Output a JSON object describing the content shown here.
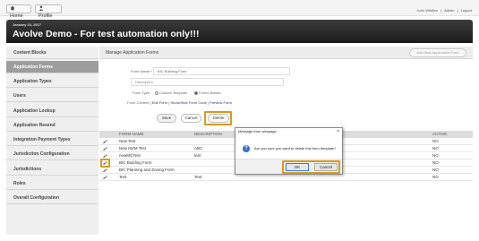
{
  "topbar": {
    "home_label": "Home",
    "profile_label": "Profile",
    "user_name": "John Whitten",
    "admin_label": "Admin",
    "logout_label": "Logout",
    "separator": "|"
  },
  "banner": {
    "date": "January 24, 2017",
    "title": "Avolve Demo - For test automation only!!!"
  },
  "sidebar": {
    "items": [
      {
        "label": "Content Blocks"
      },
      {
        "label": "Application Forms"
      },
      {
        "label": "Application Types"
      },
      {
        "label": "Users"
      },
      {
        "label": "Application Lookup"
      },
      {
        "label": "Application Resend"
      },
      {
        "label": "Integration Payment Types"
      },
      {
        "label": "Jurisdiction Configuration"
      },
      {
        "label": "Jurisdictions"
      },
      {
        "label": "Roles"
      },
      {
        "label": "Overall Configuration"
      }
    ]
  },
  "main": {
    "header_title": "Manage Application Forms",
    "add_button": "Add New Application Form",
    "form_name_label": "Form Name",
    "required_mark": "*",
    "form_name_value": "BIC Building Form",
    "description_placeholder": "Description",
    "form_type_label": "Form Type",
    "custom_template_label": "Custom Template",
    "forms_builder_label": "Forms Builder",
    "form_content_label": "Form Content",
    "edit_form_link": "Edit Form",
    "show_hide_code_link": "Show/Hide Form Code",
    "preview_form_link": "Preview Form",
    "link_separator": "|",
    "save_button": "Save",
    "cancel_button": "Cancel",
    "delete_button": "Delete"
  },
  "table": {
    "headers": {
      "form_name": "FORM NAME",
      "description": "DESCRIPTION",
      "active": "ACTIVE"
    },
    "rows": [
      {
        "name": "New Test",
        "description": "",
        "active": "NO"
      },
      {
        "name": "New MZM Test",
        "description": "ABC",
        "active": "NO"
      },
      {
        "name": "newMGTest",
        "description": "test",
        "active": "NO"
      },
      {
        "name": "BIC Building Form",
        "description": "",
        "active": "NO"
      },
      {
        "name": "BIC Planning and Zoning Form",
        "description": "",
        "active": "NO"
      },
      {
        "name": "Test",
        "description": "Test",
        "active": "NO"
      }
    ]
  },
  "dialog": {
    "title": "Message from webpage",
    "close_glyph": "×",
    "question_glyph": "?",
    "message": "Are you sure you want to delete this form template?",
    "ok_label": "OK",
    "cancel_label": "Cancel"
  },
  "colors": {
    "banner": "#2a2a2a",
    "sidebar_active": "#9d9d9d",
    "highlight": "#d89a1e",
    "dialog_icon": "#2f6fc8"
  }
}
